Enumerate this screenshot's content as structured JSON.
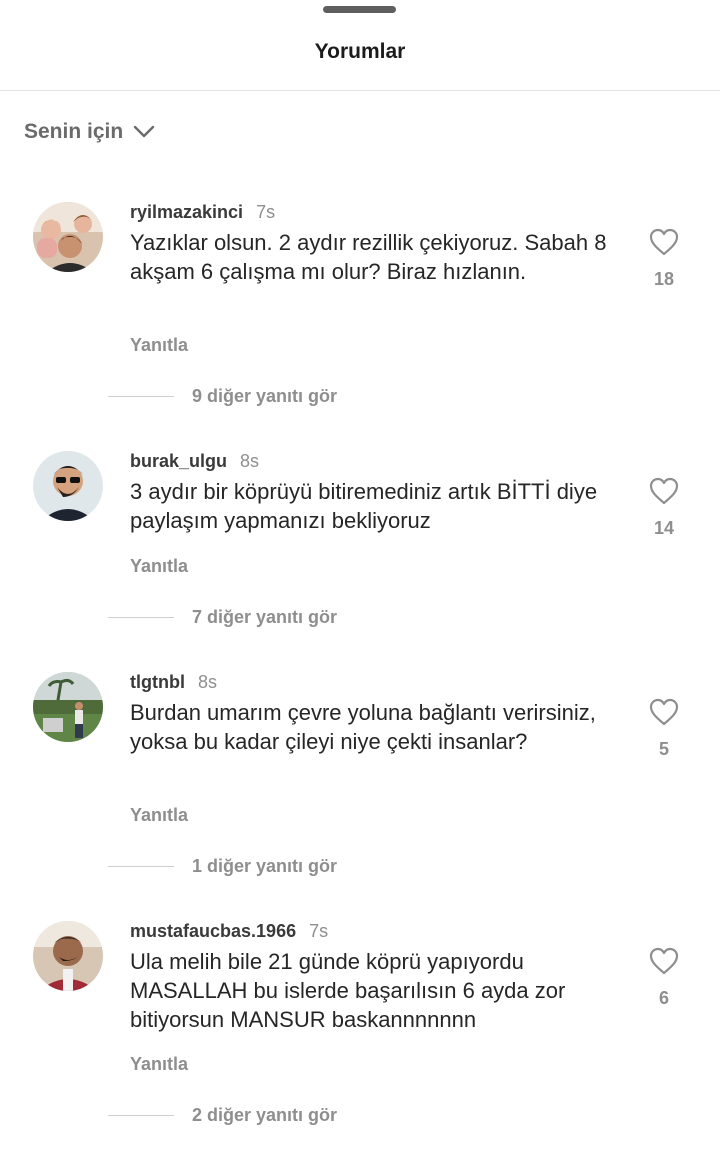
{
  "header": {
    "title": "Yorumlar"
  },
  "sort": {
    "label": "Senin için"
  },
  "comments": [
    {
      "username": "ryilmazakinci",
      "time": "7s",
      "text": "Yazıklar olsun. 2 aydır rezillik çekiyoruz. Sabah 8 akşam 6 çalışma mı olur? Biraz hızlanın.",
      "likes": "18",
      "reply_label": "Yanıtla",
      "more_replies": "9 diğer yanıtı gör"
    },
    {
      "username": "burak_ulgu",
      "time": "8s",
      "text": "3 aydır bir köprüyü bitiremediniz artık BİTTİ diye paylaşım yapmanızı bekliyoruz",
      "likes": "14",
      "reply_label": "Yanıtla",
      "more_replies": "7 diğer yanıtı gör"
    },
    {
      "username": "tlgtnbl",
      "time": "8s",
      "text": "Burdan umarım çevre yoluna bağlantı verirsiniz, yoksa bu kadar çileyi niye çekti insanlar?",
      "likes": "5",
      "reply_label": "Yanıtla",
      "more_replies": "1 diğer yanıtı gör"
    },
    {
      "username": "mustafaucbas.1966",
      "time": "7s",
      "text": "Ula melih bile 21 günde köprü yapıyordu MASALLAH bu  islerde başarılısın 6 ayda zor bitiyorsun MANSUR baskannnnnnn",
      "likes": "6",
      "reply_label": "Yanıtla",
      "more_replies": "2 diğer yanıtı gör"
    }
  ],
  "icons": {
    "drag_handle": "drag-handle",
    "sort": "chevron-down-icon",
    "like": "heart-icon"
  },
  "colors": {
    "text_primary": "#262626",
    "text_secondary": "#8e8e8e",
    "divider": "#e4e4e4"
  }
}
